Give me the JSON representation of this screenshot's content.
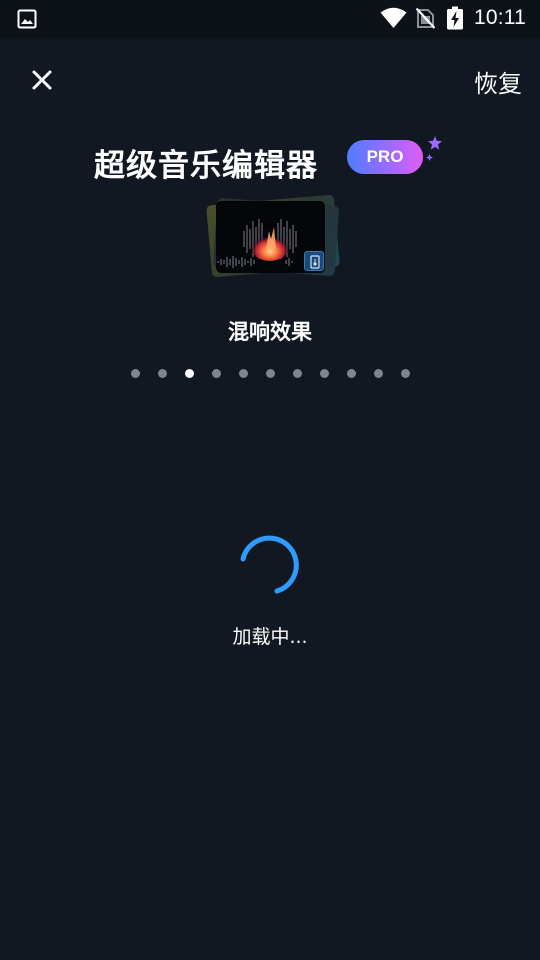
{
  "status_bar": {
    "time": "10:11",
    "icons": [
      "image-icon",
      "wifi-icon",
      "no-sim-icon",
      "battery-charging-icon"
    ]
  },
  "header": {
    "close_icon": "close-icon",
    "restore_label": "恢复"
  },
  "promo": {
    "title": "超级音乐编辑器",
    "badge": "PRO",
    "feature_label": "混响效果",
    "page_indicator": {
      "total": 11,
      "active_index": 2
    }
  },
  "loading": {
    "text": "加载中..."
  },
  "colors": {
    "background": "#121822",
    "statusbar": "#0d1118",
    "spinner": "#2f9bff",
    "dot_inactive": "#7d8591",
    "dot_active": "#ffffff",
    "badge_gradient": [
      "#4f7dff",
      "#9b6bff",
      "#e25bf6"
    ],
    "sparkle": "#9b6bff"
  }
}
